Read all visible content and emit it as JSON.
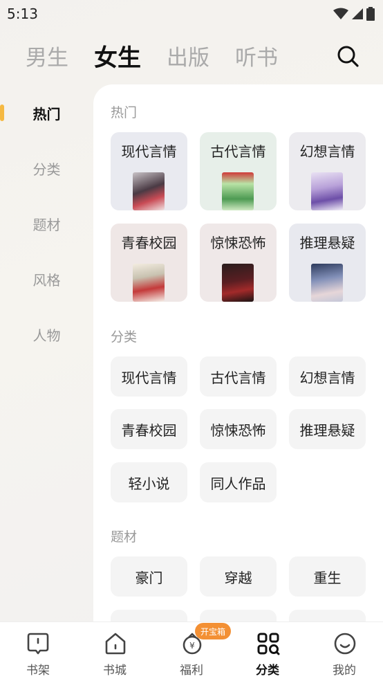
{
  "status_bar": {
    "time": "5:13"
  },
  "top_tabs": [
    "男生",
    "女生",
    "出版",
    "听书"
  ],
  "active_top_tab": "女生",
  "sidebar": {
    "items": [
      "热门",
      "分类",
      "题材",
      "风格",
      "人物"
    ],
    "active": "热门"
  },
  "sections": {
    "hot": {
      "title": "热门",
      "cards": [
        {
          "label": "现代言情",
          "bg": "#e9eaf0"
        },
        {
          "label": "古代言情",
          "bg": "#e7efe9"
        },
        {
          "label": "幻想言情",
          "bg": "#ecebef"
        },
        {
          "label": "青春校园",
          "bg": "#efe7e6"
        },
        {
          "label": "惊悚恐怖",
          "bg": "#efe8e8"
        },
        {
          "label": "推理悬疑",
          "bg": "#e8e9ef"
        }
      ]
    },
    "category": {
      "title": "分类",
      "chips": [
        "现代言情",
        "古代言情",
        "幻想言情",
        "青春校园",
        "惊悚恐怖",
        "推理悬疑",
        "轻小说",
        "同人作品"
      ]
    },
    "theme": {
      "title": "题材",
      "chips": [
        "豪门",
        "穿越",
        "重生"
      ]
    }
  },
  "bottom_nav": {
    "items": [
      "书架",
      "书城",
      "福利",
      "分类",
      "我的"
    ],
    "active": "分类",
    "badge": "开宝箱"
  },
  "colors": {
    "accent": "#f5b942",
    "badge": "#f39034"
  }
}
